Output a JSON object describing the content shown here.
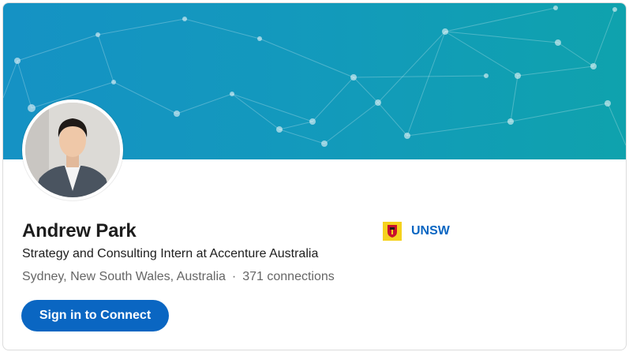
{
  "profile": {
    "name": "Andrew Park",
    "headline": "Strategy and Consulting Intern at Accenture Australia",
    "location": "Sydney, New South Wales, Australia",
    "separator": "·",
    "connections": "371 connections",
    "avatar_icon": "profile-photo"
  },
  "education": {
    "school": "UNSW",
    "logo_icon": "unsw-crest-icon",
    "logo_color": "#f5d21e"
  },
  "actions": {
    "connect_label": "Sign in to Connect"
  },
  "colors": {
    "accent": "#0a66c2",
    "banner_start": "#1592c4",
    "banner_end": "#0fa2ad"
  }
}
